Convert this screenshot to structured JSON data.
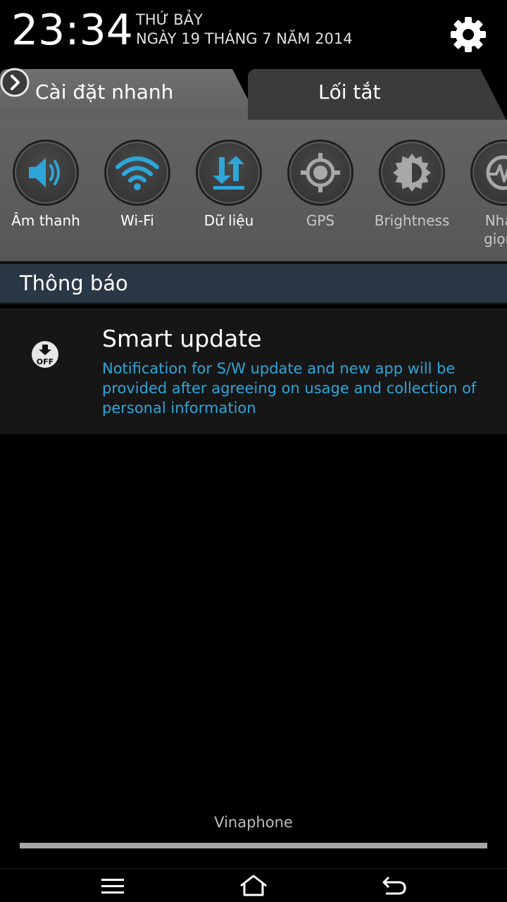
{
  "status": {
    "time": "23:34",
    "weekday": "THỨ BẢY",
    "date": "NGÀY 19 THÁNG 7 NĂM 2014"
  },
  "tabs": {
    "quick_settings": "Cài đặt nhanh",
    "shortcuts": "Lối tắt"
  },
  "quick_settings": [
    {
      "label": "Âm thanh",
      "icon": "volume-icon",
      "state": "on"
    },
    {
      "label": "Wi-Fi",
      "icon": "wifi-icon",
      "state": "on"
    },
    {
      "label": "Dữ liệu",
      "icon": "mobile-data-icon",
      "state": "on"
    },
    {
      "label": "GPS",
      "icon": "gps-icon",
      "state": "off"
    },
    {
      "label": "Brightness",
      "icon": "brightness-icon",
      "state": "off"
    },
    {
      "label": "Nhận\ngiọng",
      "icon": "voice-icon",
      "state": "off"
    }
  ],
  "notifications": {
    "header": "Thông báo",
    "items": [
      {
        "title": "Smart update",
        "text": "Notification for S/W update and new app will be provided after agreeing on usage and collection of personal information",
        "icon": "update-off-icon"
      }
    ]
  },
  "carrier": "Vinaphone",
  "colors": {
    "accent": "#2ea6d9",
    "notif_header_bg": "#2a3744",
    "panel_bg": "#5d5d5d"
  }
}
